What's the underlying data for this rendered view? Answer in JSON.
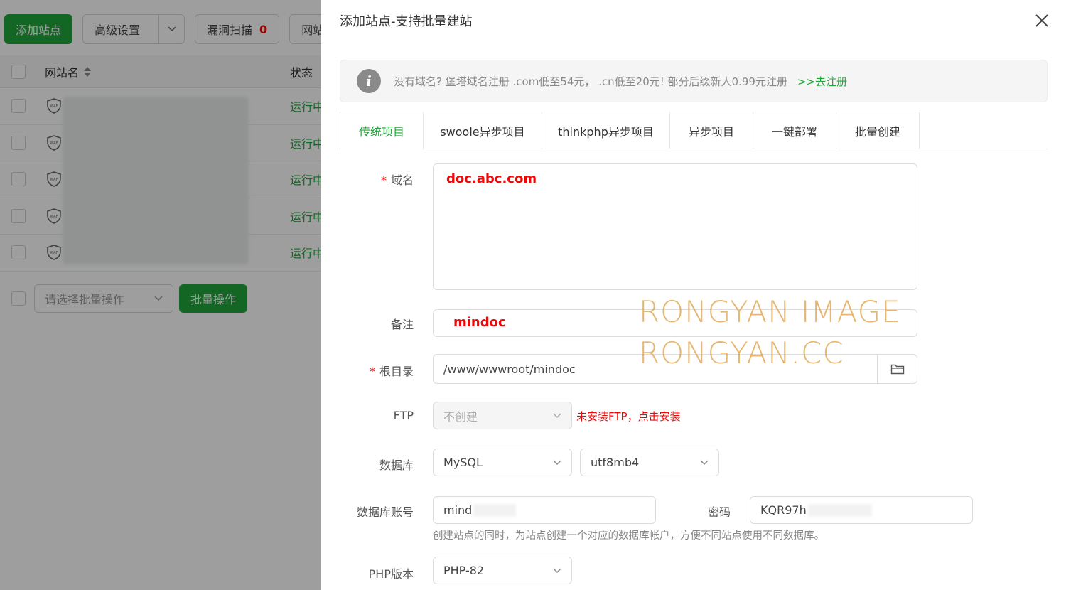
{
  "background": {
    "toolbar": {
      "add_site": "添加站点",
      "advanced": "高级设置",
      "vuln_scan": "漏洞扫描",
      "vuln_count": "0",
      "site_tab": "网站"
    },
    "table": {
      "col_name": "网站名",
      "col_status": "状态",
      "rows": [
        {
          "status": "运行中"
        },
        {
          "status": "运行中"
        },
        {
          "status": "运行中"
        },
        {
          "status": "运行中"
        },
        {
          "status": "运行中"
        }
      ]
    },
    "batch": {
      "select_placeholder": "请选择批量操作",
      "button": "批量操作"
    }
  },
  "modal": {
    "title": "添加站点-支持批量建站",
    "notice": {
      "text": "没有域名? 堡塔域名注册 .com低至54元， .cn低至20元! 部分后缀新人0.99元注册",
      "link": ">>去注册"
    },
    "tabs": [
      {
        "label": "传统项目",
        "active": true
      },
      {
        "label": "swoole异步项目",
        "active": false
      },
      {
        "label": "thinkphp异步项目",
        "active": false
      },
      {
        "label": "异步项目",
        "active": false
      },
      {
        "label": "一键部署",
        "active": false
      },
      {
        "label": "批量创建",
        "active": false
      }
    ],
    "form": {
      "domain_label": "域名",
      "domain_value": "doc.abc.com",
      "remark_label": "备注",
      "remark_value": "mindoc",
      "root_label": "根目录",
      "root_value": "/www/wwwroot/mindoc",
      "ftp_label": "FTP",
      "ftp_value": "不创建",
      "ftp_warning": "未安装FTP，点击安装",
      "db_label": "数据库",
      "db_type": "MySQL",
      "db_charset": "utf8mb4",
      "db_user_label": "数据库账号",
      "db_user_value": "mind",
      "db_pass_label": "密码",
      "db_pass_value": "KQR97h",
      "db_hint": "创建站点的同时，为站点创建一个对应的数据库帐户，方便不同站点使用不同数据库。",
      "php_label": "PHP版本",
      "php_value": "PHP-82"
    }
  },
  "watermark": {
    "line1": "RONGYAN IMAGE",
    "line2": "RONGYAN.CC"
  },
  "colors": {
    "brand_green": "#20a53a",
    "danger_red": "#ef0808"
  }
}
